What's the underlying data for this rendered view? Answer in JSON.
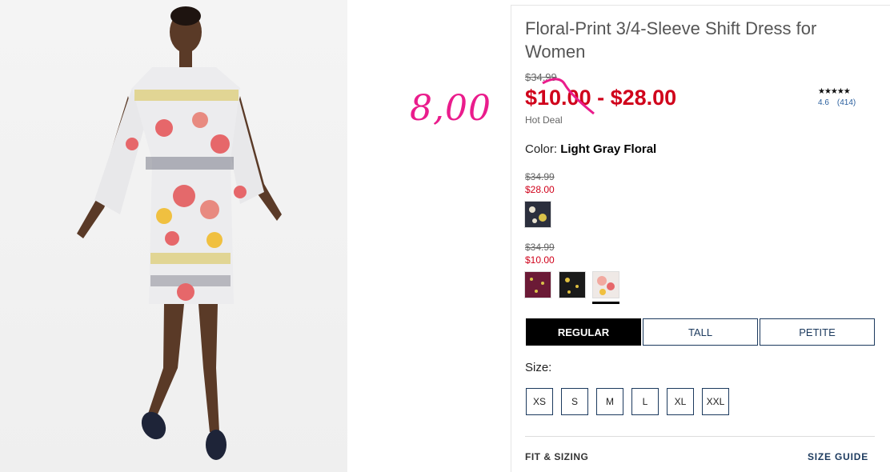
{
  "product": {
    "title": "Floral-Print 3/4-Sleeve Shift Dress for Women",
    "original_price": "$34.99",
    "sale_price_low": "$10.00",
    "sale_price_sep": " - ",
    "sale_price_high": "$28.00",
    "deal_label": "Hot Deal"
  },
  "annotation": "8,00",
  "rating": {
    "stars": "★★★★★",
    "value": "4.6",
    "count": "(414)"
  },
  "color": {
    "label": "Color: ",
    "selected": "Light Gray Floral"
  },
  "price_groups": [
    {
      "was": "$34.99",
      "now": "$28.00"
    },
    {
      "was": "$34.99",
      "now": "$10.00"
    }
  ],
  "swatches": [
    {
      "name": "navy-floral",
      "color": "#2b2f3d"
    },
    {
      "name": "burgundy-floral",
      "color": "#6b1a36"
    },
    {
      "name": "black-floral",
      "color": "#1a1a1a"
    },
    {
      "name": "light-gray-floral",
      "color": "#efe9e6"
    }
  ],
  "fit_tabs": [
    {
      "label": "REGULAR",
      "active": true
    },
    {
      "label": "TALL",
      "active": false
    },
    {
      "label": "PETITE",
      "active": false
    }
  ],
  "size_label": "Size:",
  "sizes": [
    "XS",
    "S",
    "M",
    "L",
    "XL",
    "XXL"
  ],
  "footer": {
    "fit_sizing": "FIT & SIZING",
    "size_guide": "SIZE GUIDE"
  },
  "colors": {
    "sale_red": "#d0021b",
    "annotation_pink": "#ea1c8c",
    "navy": "#1c3a5e"
  }
}
